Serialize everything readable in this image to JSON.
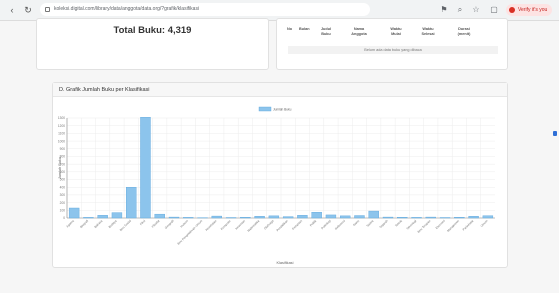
{
  "browser": {
    "url": "koleksi.digital.com/library/data/anggota/data.org/?grafik/klasifikasi",
    "profile_label": "Verify it's you"
  },
  "summary": {
    "total_label": "Total Buku: 4,319"
  },
  "borrow_table": {
    "headers": [
      "No",
      "Bulan",
      "Judul Buku",
      "Nama Anggota",
      "Waktu Mulai",
      "Waktu Selesai",
      "Durasi (menit)"
    ],
    "empty_message": "Belum ada data buku yang dibaca"
  },
  "chart_section": {
    "header": "D. Grafik Jumlah Buku per Klasifikasi"
  },
  "chart_data": {
    "type": "bar",
    "legend": [
      "Jumlah Buku"
    ],
    "legend_position": "top",
    "xlabel": "Klasifikasi",
    "ylabel": "Jumlah Buku",
    "grid": true,
    "ylim": [
      0,
      1300
    ],
    "yticks": [
      0,
      100,
      200,
      300,
      400,
      500,
      600,
      700,
      800,
      900,
      1000,
      1100,
      1200,
      1300
    ],
    "categories": [
      "Agama",
      "Biografi",
      "Bahasa",
      "Budaya",
      "Ilmu Sosial",
      "Fiksi",
      "Filsafat",
      "Geografi",
      "Hukum",
      "Ilmu Pengetahuan Umum",
      "Kesehatan",
      "Komputer",
      "Kesenian",
      "Matematika",
      "Olahraga",
      "Pendidikan",
      "Pertanian",
      "Politik",
      "Psikologi",
      "Referensi",
      "Sains",
      "Sastra",
      "Sejarah",
      "Teknik",
      "Teknologi",
      "Ilmu Terapan",
      "Ekonomi",
      "Manajemen",
      "Pariwisata",
      "Umum"
    ],
    "values": [
      130,
      8,
      35,
      70,
      400,
      1310,
      50,
      12,
      8,
      4,
      25,
      6,
      10,
      22,
      28,
      18,
      35,
      75,
      40,
      28,
      32,
      90,
      12,
      10,
      8,
      12,
      6,
      10,
      22,
      30
    ],
    "colors": {
      "bar_fill": "#8cc4ec",
      "bar_stroke": "#5aa5dc",
      "grid": "#ececec",
      "axis": "#888888"
    }
  }
}
